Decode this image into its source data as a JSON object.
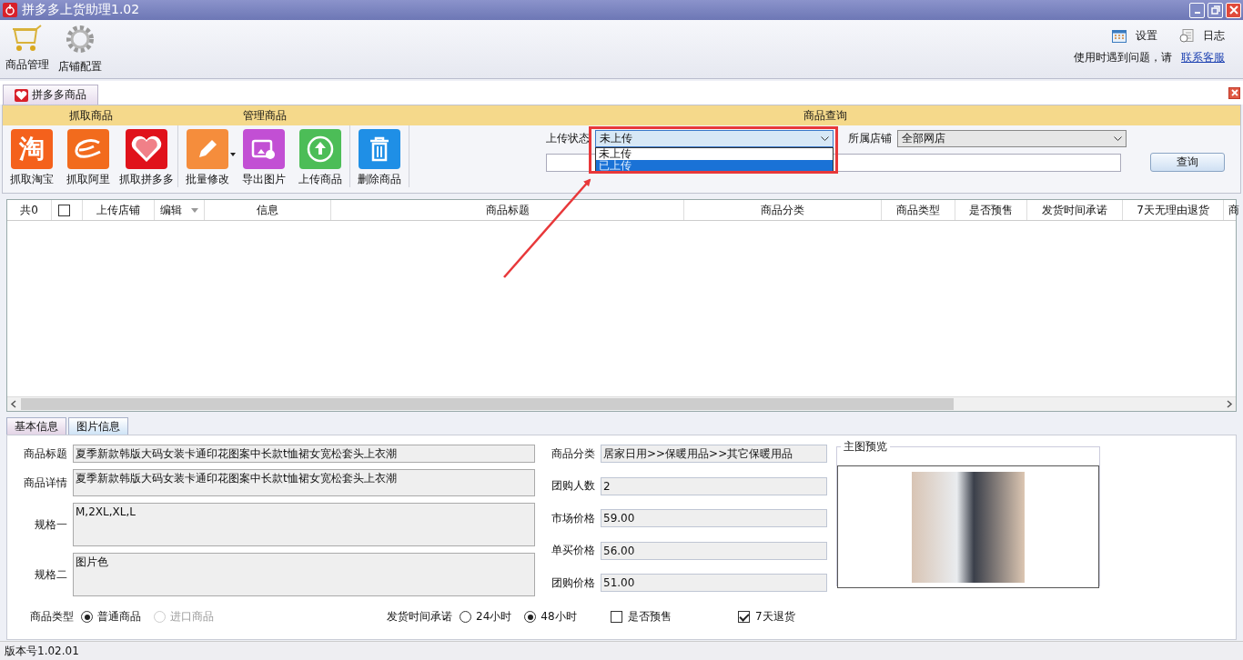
{
  "window": {
    "title": "拼多多上货助理1.02"
  },
  "toolbar": {
    "items": [
      {
        "label": "商品管理",
        "kind": "cart"
      },
      {
        "label": "店铺配置",
        "kind": "gear"
      }
    ],
    "right_items": [
      {
        "label": "设置",
        "kind": "calendar"
      },
      {
        "label": "日志",
        "kind": "log"
      }
    ],
    "help_text": "使用时遇到问题，请",
    "help_link": "联系客服"
  },
  "tabs": [
    {
      "label": "拼多多商品",
      "selected": true
    }
  ],
  "ribbon": {
    "groups": [
      {
        "title": "抓取商品",
        "buttons": [
          {
            "label": "抓取淘宝",
            "kind": "taobao",
            "glyph": "淘"
          },
          {
            "label": "抓取阿里",
            "kind": "ali"
          },
          {
            "label": "抓取拼多多",
            "kind": "pdd"
          }
        ]
      },
      {
        "title": "管理商品",
        "buttons": [
          {
            "label": "批量修改",
            "kind": "edit",
            "dropdown": true
          },
          {
            "label": "导出图片",
            "kind": "images"
          },
          {
            "label": "上传商品",
            "kind": "upload"
          }
        ]
      },
      {
        "buttons": [
          {
            "label": "删除商品",
            "kind": "delete"
          }
        ]
      }
    ],
    "query": {
      "title": "商品查询",
      "status_label": "上传状态",
      "status_value": "未上传",
      "status_options": [
        {
          "label": "未上传",
          "selected": false
        },
        {
          "label": "已上传",
          "selected": true
        }
      ],
      "shop_label": "所属店铺",
      "shop_value": "全部网店",
      "search_button": "查询"
    }
  },
  "table": {
    "count": "共0",
    "select_all": {
      "checked": false
    },
    "columns": [
      {
        "label": "上传店铺"
      },
      {
        "label": "编辑",
        "sortable": true
      },
      {
        "label": "信息"
      },
      {
        "label": "商品标题"
      },
      {
        "label": "商品分类"
      },
      {
        "label": "商品类型"
      },
      {
        "label": "是否预售"
      },
      {
        "label": "发货时间承诺"
      },
      {
        "label": "7天无理由退货"
      },
      {
        "label": "商"
      }
    ]
  },
  "detail_tabs": [
    {
      "label": "基本信息",
      "selected": true
    },
    {
      "label": "图片信息",
      "selected": false
    }
  ],
  "form": {
    "left_fields": [
      {
        "label": "商品标题",
        "value": "夏季新款韩版大码女装卡通印花图案中长款t恤裙女宽松套头上衣潮",
        "kind": "single"
      },
      {
        "label": "商品详情",
        "value": "夏季新款韩版大码女装卡通印花图案中长款t恤裙女宽松套头上衣潮",
        "kind": "medium"
      },
      {
        "label": "规格一",
        "value": "M,2XL,XL,L",
        "kind": "tall"
      },
      {
        "label": "规格二",
        "value": "图片色",
        "kind": "tall"
      }
    ],
    "right_fields": [
      {
        "label": "商品分类",
        "value": "居家日用>>保暖用品>>其它保暖用品"
      },
      {
        "label": "团购人数",
        "value": "2"
      },
      {
        "label": "市场价格",
        "value": "59.00"
      },
      {
        "label": "单买价格",
        "value": "56.00"
      },
      {
        "label": "团购价格",
        "value": "51.00"
      }
    ],
    "preview_title": "主图预览",
    "type_label": "商品类型",
    "type_options": [
      {
        "label": "普通商品",
        "selected": true,
        "disabled": false
      },
      {
        "label": "进口商品",
        "selected": false,
        "disabled": true
      }
    ],
    "ship_label": "发货时间承诺",
    "ship_options": [
      {
        "label": "24小时",
        "selected": false,
        "disabled": false
      },
      {
        "label": "48小时",
        "selected": true,
        "disabled": false
      }
    ],
    "checks": [
      {
        "label": "是否预售",
        "checked": false
      },
      {
        "label": "7天退货",
        "checked": true
      }
    ]
  },
  "status_bar": {
    "version": "版本号1.02.01"
  }
}
